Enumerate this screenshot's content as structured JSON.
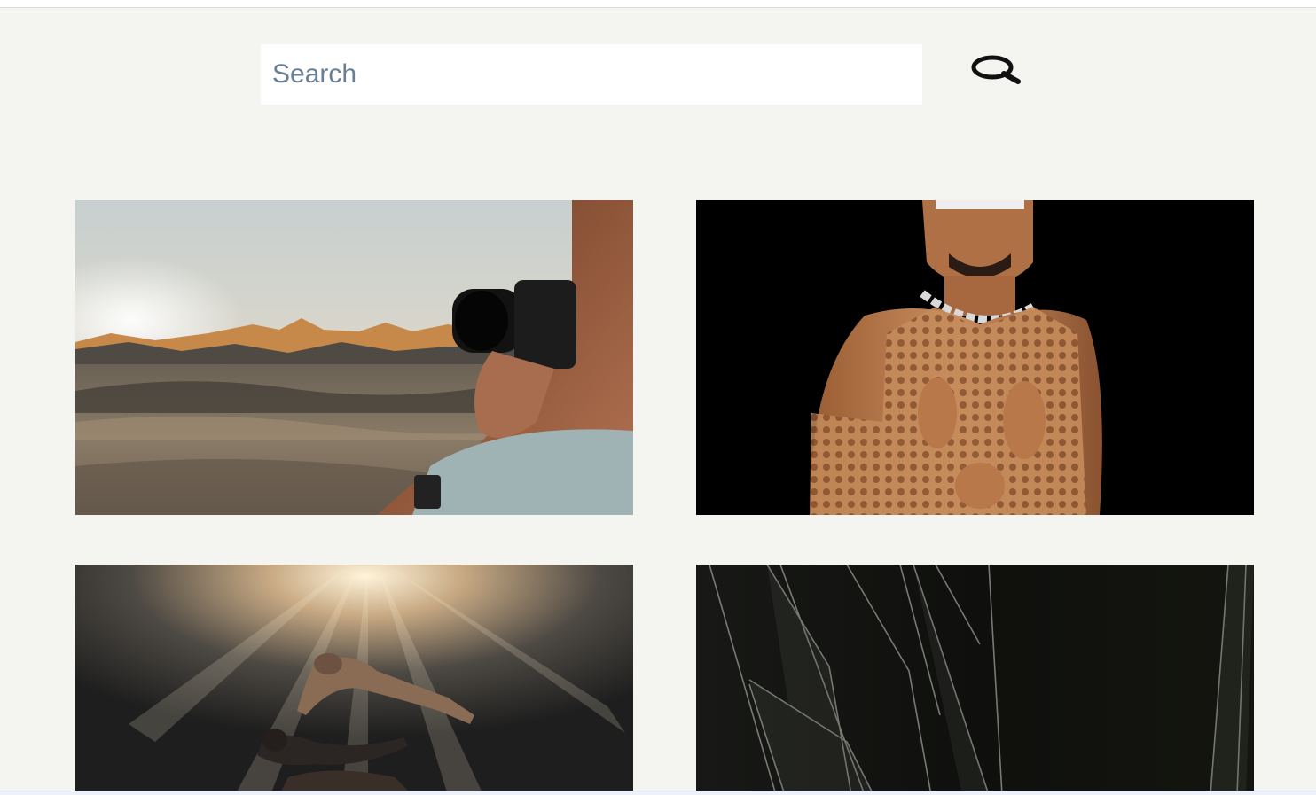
{
  "search": {
    "placeholder": "Search",
    "button_icon": "search-icon"
  },
  "colors": {
    "background": "#f4f4f0",
    "input_background": "#ffffff",
    "placeholder_text": "#6a7f94"
  },
  "gallery": {
    "images": [
      {
        "subject": "desert-photographer-image"
      },
      {
        "subject": "mesh-top-portrait-image"
      },
      {
        "subject": "underwater-swimmers-image"
      },
      {
        "subject": "dark-glass-shards-image"
      }
    ]
  }
}
